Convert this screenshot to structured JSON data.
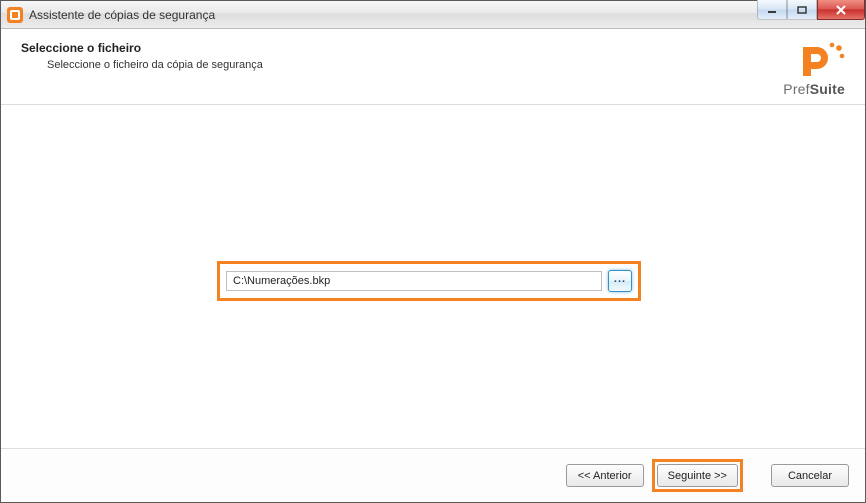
{
  "window": {
    "title": "Assistente de cópias de segurança"
  },
  "header": {
    "heading": "Seleccione o ficheiro",
    "subtitle": "Seleccione o ficheiro da cópia de segurança"
  },
  "brand": {
    "name_prefix": "Pref",
    "name_suffix": "Suite",
    "accent_color": "#f58220"
  },
  "file": {
    "path": "C:\\Numerações.bkp",
    "browse_label": "..."
  },
  "footer": {
    "prev": "<< Anterior",
    "next": "Seguinte >>",
    "cancel": "Cancelar"
  }
}
